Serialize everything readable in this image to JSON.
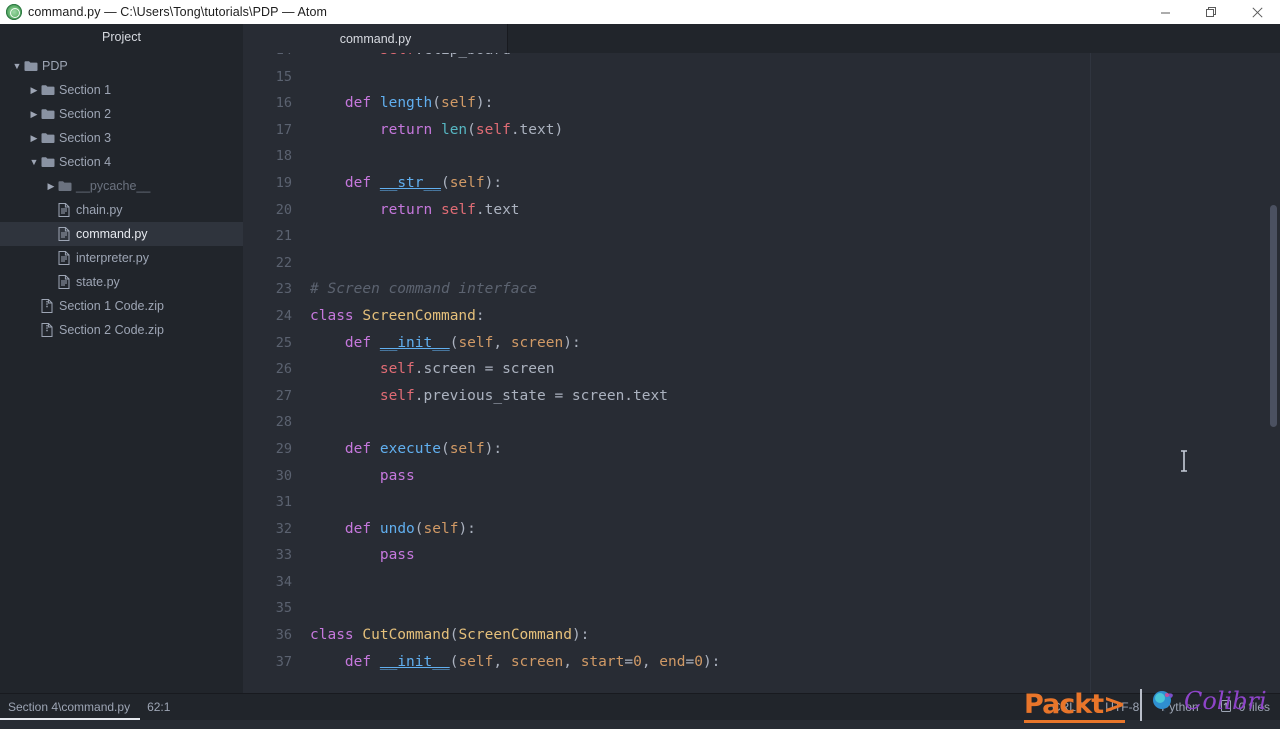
{
  "window": {
    "title": "command.py — C:\\Users\\Tong\\tutorials\\PDP — Atom",
    "app_icon": "atom-logo-icon",
    "controls": {
      "minimize": "minimize-icon",
      "maximize": "restore-icon",
      "close": "close-icon"
    }
  },
  "sidebar": {
    "header": "Project",
    "items": [
      {
        "label": "PDP",
        "type": "folder",
        "depth": 0,
        "twisty": "down",
        "selected": false
      },
      {
        "label": "Section 1",
        "type": "folder",
        "depth": 1,
        "twisty": "right",
        "selected": false
      },
      {
        "label": "Section 2",
        "type": "folder",
        "depth": 1,
        "twisty": "right",
        "selected": false
      },
      {
        "label": "Section 3",
        "type": "folder",
        "depth": 1,
        "twisty": "right",
        "selected": false
      },
      {
        "label": "Section 4",
        "type": "folder",
        "depth": 1,
        "twisty": "down",
        "selected": false
      },
      {
        "label": "__pycache__",
        "type": "folder",
        "depth": 2,
        "twisty": "right",
        "selected": false,
        "dim": true
      },
      {
        "label": "chain.py",
        "type": "file",
        "depth": 2,
        "twisty": "none",
        "selected": false
      },
      {
        "label": "command.py",
        "type": "file",
        "depth": 2,
        "twisty": "none",
        "selected": true
      },
      {
        "label": "interpreter.py",
        "type": "file",
        "depth": 2,
        "twisty": "none",
        "selected": false
      },
      {
        "label": "state.py",
        "type": "file",
        "depth": 2,
        "twisty": "none",
        "selected": false
      },
      {
        "label": "Section 1 Code.zip",
        "type": "zip",
        "depth": 1,
        "twisty": "none",
        "selected": false
      },
      {
        "label": "Section 2 Code.zip",
        "type": "zip",
        "depth": 1,
        "twisty": "none",
        "selected": false
      }
    ]
  },
  "tabs": [
    {
      "label": "command.py",
      "active": true
    }
  ],
  "editor": {
    "language": "Python",
    "lines": [
      {
        "n": "14",
        "tokens": [
          {
            "t": "        ",
            "c": "punc"
          },
          {
            "t": "self",
            "c": "self"
          },
          {
            "t": ".clip_board ",
            "c": "ident"
          },
          {
            "t": "=",
            "c": "punc"
          }
        ]
      },
      {
        "n": "15",
        "tokens": []
      },
      {
        "n": "16",
        "tokens": [
          {
            "t": "    ",
            "c": "punc"
          },
          {
            "t": "def",
            "c": "kw"
          },
          {
            "t": " ",
            "c": "punc"
          },
          {
            "t": "length",
            "c": "fn"
          },
          {
            "t": "(",
            "c": "punc"
          },
          {
            "t": "self",
            "c": "param"
          },
          {
            "t": "):",
            "c": "punc"
          }
        ]
      },
      {
        "n": "17",
        "tokens": [
          {
            "t": "        ",
            "c": "punc"
          },
          {
            "t": "return",
            "c": "kw"
          },
          {
            "t": " ",
            "c": "punc"
          },
          {
            "t": "len",
            "c": "bi"
          },
          {
            "t": "(",
            "c": "punc"
          },
          {
            "t": "self",
            "c": "self"
          },
          {
            "t": ".text",
            "c": "ident"
          },
          {
            "t": ")",
            "c": "punc"
          }
        ]
      },
      {
        "n": "18",
        "tokens": []
      },
      {
        "n": "19",
        "tokens": [
          {
            "t": "    ",
            "c": "punc"
          },
          {
            "t": "def",
            "c": "kw"
          },
          {
            "t": " ",
            "c": "punc"
          },
          {
            "t": "__str__",
            "c": "dun"
          },
          {
            "t": "(",
            "c": "punc"
          },
          {
            "t": "self",
            "c": "param"
          },
          {
            "t": "):",
            "c": "punc"
          }
        ]
      },
      {
        "n": "20",
        "tokens": [
          {
            "t": "        ",
            "c": "punc"
          },
          {
            "t": "return",
            "c": "kw"
          },
          {
            "t": " ",
            "c": "punc"
          },
          {
            "t": "self",
            "c": "self"
          },
          {
            "t": ".text",
            "c": "ident"
          }
        ]
      },
      {
        "n": "21",
        "tokens": []
      },
      {
        "n": "22",
        "tokens": []
      },
      {
        "n": "23",
        "tokens": [
          {
            "t": "# Screen command interface",
            "c": "cmt"
          }
        ]
      },
      {
        "n": "24",
        "tokens": [
          {
            "t": "class",
            "c": "kw"
          },
          {
            "t": " ",
            "c": "punc"
          },
          {
            "t": "ScreenCommand",
            "c": "cls"
          },
          {
            "t": ":",
            "c": "punc"
          }
        ]
      },
      {
        "n": "25",
        "tokens": [
          {
            "t": "    ",
            "c": "punc"
          },
          {
            "t": "def",
            "c": "kw"
          },
          {
            "t": " ",
            "c": "punc"
          },
          {
            "t": "__init__",
            "c": "dun"
          },
          {
            "t": "(",
            "c": "punc"
          },
          {
            "t": "self",
            "c": "param"
          },
          {
            "t": ", ",
            "c": "punc"
          },
          {
            "t": "screen",
            "c": "param"
          },
          {
            "t": "):",
            "c": "punc"
          }
        ]
      },
      {
        "n": "26",
        "tokens": [
          {
            "t": "        ",
            "c": "punc"
          },
          {
            "t": "self",
            "c": "self"
          },
          {
            "t": ".screen ",
            "c": "ident"
          },
          {
            "t": "=",
            "c": "punc"
          },
          {
            "t": " screen",
            "c": "ident"
          }
        ]
      },
      {
        "n": "27",
        "tokens": [
          {
            "t": "        ",
            "c": "punc"
          },
          {
            "t": "self",
            "c": "self"
          },
          {
            "t": ".previous_state ",
            "c": "ident"
          },
          {
            "t": "=",
            "c": "punc"
          },
          {
            "t": " screen.text",
            "c": "ident"
          }
        ]
      },
      {
        "n": "28",
        "tokens": []
      },
      {
        "n": "29",
        "tokens": [
          {
            "t": "    ",
            "c": "punc"
          },
          {
            "t": "def",
            "c": "kw"
          },
          {
            "t": " ",
            "c": "punc"
          },
          {
            "t": "execute",
            "c": "fn"
          },
          {
            "t": "(",
            "c": "punc"
          },
          {
            "t": "self",
            "c": "param"
          },
          {
            "t": "):",
            "c": "punc"
          }
        ]
      },
      {
        "n": "30",
        "tokens": [
          {
            "t": "        ",
            "c": "punc"
          },
          {
            "t": "pass",
            "c": "kw"
          }
        ]
      },
      {
        "n": "31",
        "tokens": []
      },
      {
        "n": "32",
        "tokens": [
          {
            "t": "    ",
            "c": "punc"
          },
          {
            "t": "def",
            "c": "kw"
          },
          {
            "t": " ",
            "c": "punc"
          },
          {
            "t": "undo",
            "c": "fn"
          },
          {
            "t": "(",
            "c": "punc"
          },
          {
            "t": "self",
            "c": "param"
          },
          {
            "t": "):",
            "c": "punc"
          }
        ]
      },
      {
        "n": "33",
        "tokens": [
          {
            "t": "        ",
            "c": "punc"
          },
          {
            "t": "pass",
            "c": "kw"
          }
        ]
      },
      {
        "n": "34",
        "tokens": []
      },
      {
        "n": "35",
        "tokens": []
      },
      {
        "n": "36",
        "tokens": [
          {
            "t": "class",
            "c": "kw"
          },
          {
            "t": " ",
            "c": "punc"
          },
          {
            "t": "CutCommand",
            "c": "cls"
          },
          {
            "t": "(",
            "c": "punc"
          },
          {
            "t": "ScreenCommand",
            "c": "cls"
          },
          {
            "t": "):",
            "c": "punc"
          }
        ]
      },
      {
        "n": "37",
        "tokens": [
          {
            "t": "    ",
            "c": "punc"
          },
          {
            "t": "def",
            "c": "kw"
          },
          {
            "t": " ",
            "c": "punc"
          },
          {
            "t": "__init__",
            "c": "dun"
          },
          {
            "t": "(",
            "c": "punc"
          },
          {
            "t": "self",
            "c": "param"
          },
          {
            "t": ", ",
            "c": "punc"
          },
          {
            "t": "screen",
            "c": "param"
          },
          {
            "t": ", ",
            "c": "punc"
          },
          {
            "t": "start",
            "c": "param"
          },
          {
            "t": "=",
            "c": "punc"
          },
          {
            "t": "0",
            "c": "num"
          },
          {
            "t": ", ",
            "c": "punc"
          },
          {
            "t": "end",
            "c": "param"
          },
          {
            "t": "=",
            "c": "punc"
          },
          {
            "t": "0",
            "c": "num"
          },
          {
            "t": "):",
            "c": "punc"
          }
        ]
      }
    ]
  },
  "statusbar": {
    "file_path": "Section 4\\command.py",
    "cursor_position": "62:1",
    "line_ending": "CRLF",
    "encoding": "UTF-8",
    "grammar": "Python",
    "git_icon": "git-diff-icon",
    "git_files": "0 files"
  },
  "watermark": {
    "packt": "Packt>",
    "colibri": "Colibri",
    "bird_icon": "hummingbird-icon"
  },
  "colors": {
    "editor_bg": "#282c34",
    "chrome_bg": "#21252b",
    "accent_orange": "#e8752a",
    "accent_purple": "#8e44c9",
    "selection_bg": "#2f343d"
  }
}
